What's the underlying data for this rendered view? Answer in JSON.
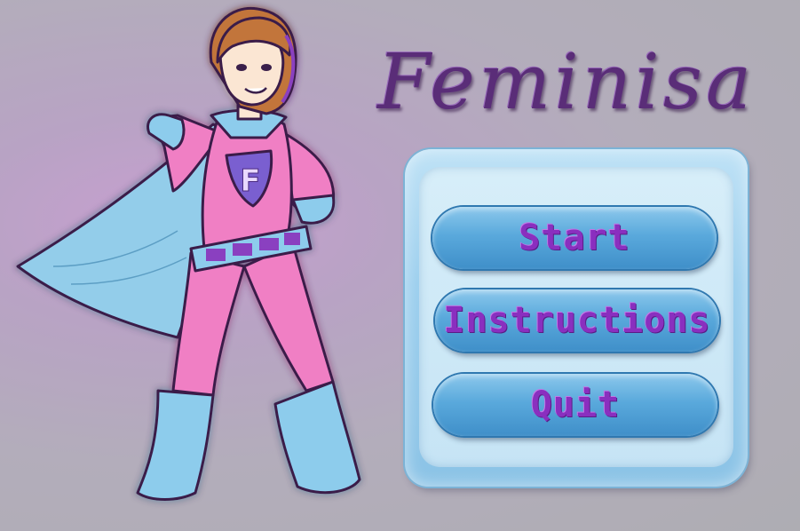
{
  "game": {
    "title": "Feminisa",
    "menu": {
      "start_label": "Start",
      "instructions_label": "Instructions",
      "quit_label": "Quit"
    },
    "hero": {
      "emblem_letter": "F"
    }
  }
}
